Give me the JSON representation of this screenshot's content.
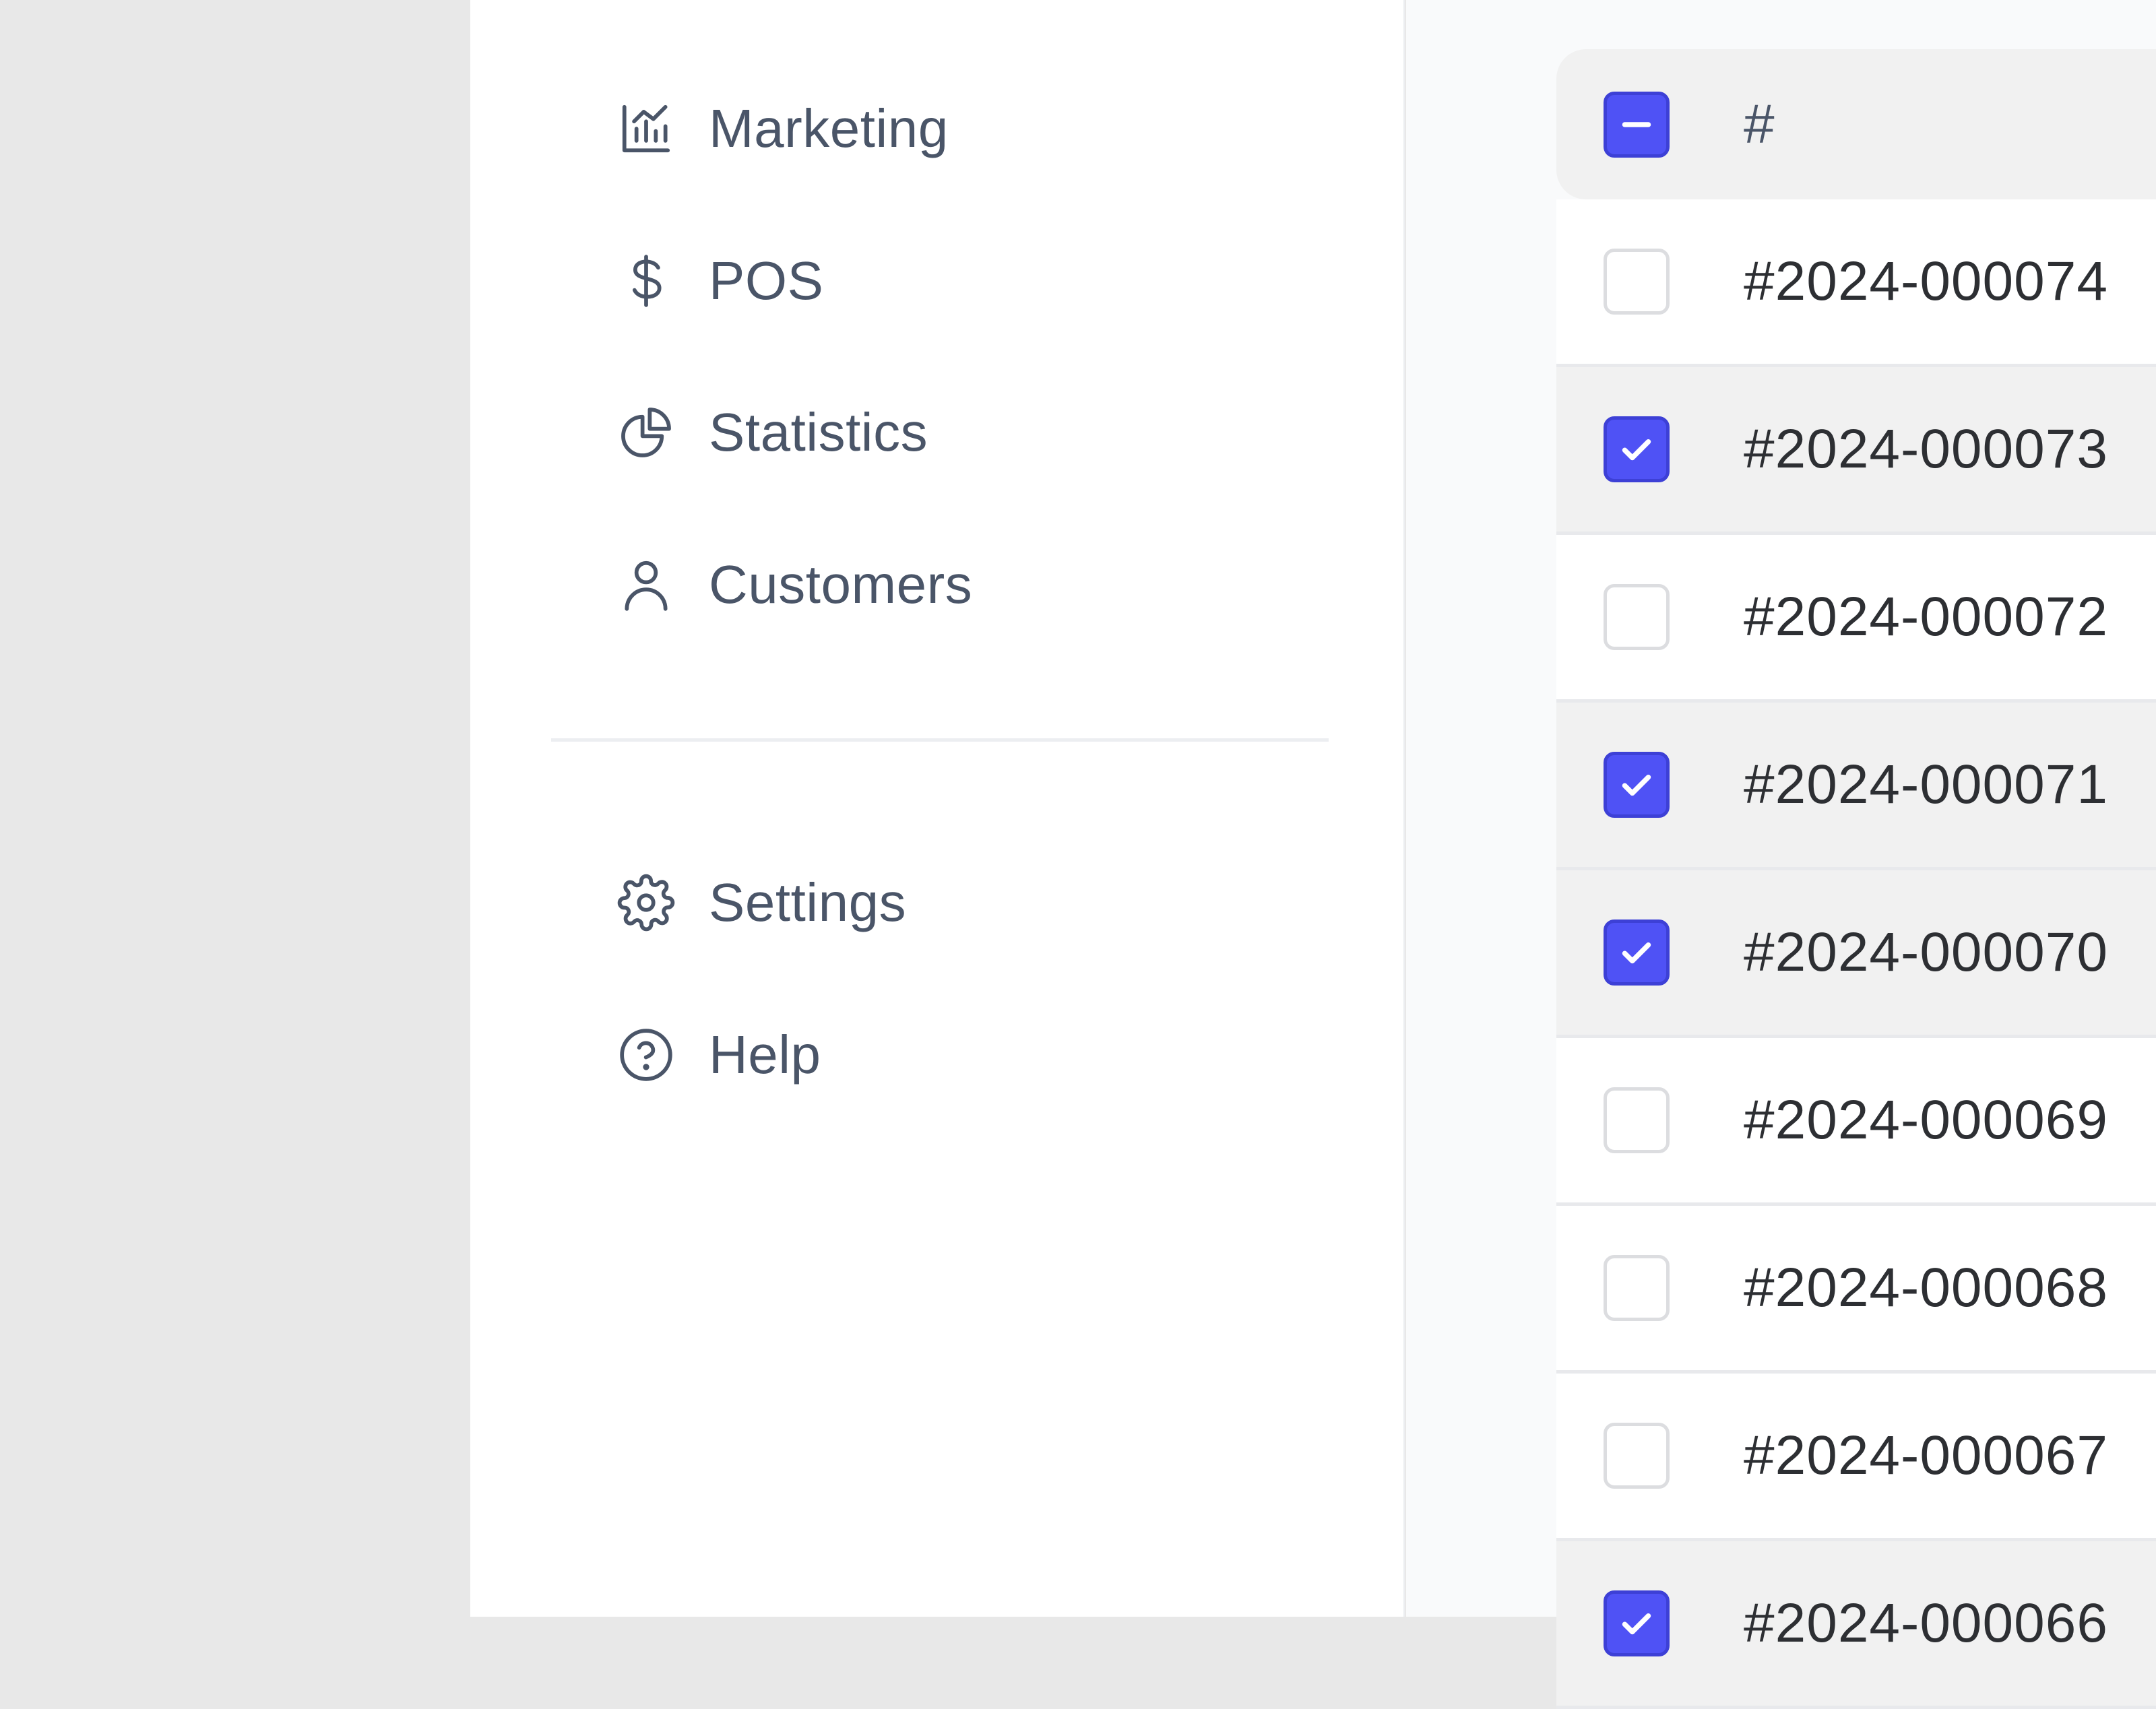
{
  "sidebar": {
    "primary_items": [
      {
        "label": "Marketing",
        "icon": "chart-icon"
      },
      {
        "label": "POS",
        "icon": "dollar-icon"
      },
      {
        "label": "Statistics",
        "icon": "pie-chart-icon"
      },
      {
        "label": "Customers",
        "icon": "user-icon"
      }
    ],
    "secondary_items": [
      {
        "label": "Settings",
        "icon": "gear-icon"
      },
      {
        "label": "Help",
        "icon": "help-circle-icon"
      }
    ]
  },
  "table": {
    "header": {
      "id_label": "#",
      "select_all_state": "indeterminate"
    },
    "rows": [
      {
        "id": "#2024-000074",
        "checked": false
      },
      {
        "id": "#2024-000073",
        "checked": true
      },
      {
        "id": "#2024-000072",
        "checked": false
      },
      {
        "id": "#2024-000071",
        "checked": true
      },
      {
        "id": "#2024-000070",
        "checked": true
      },
      {
        "id": "#2024-000069",
        "checked": false
      },
      {
        "id": "#2024-000068",
        "checked": false
      },
      {
        "id": "#2024-000067",
        "checked": false
      },
      {
        "id": "#2024-000066",
        "checked": true
      }
    ]
  },
  "colors": {
    "accent": "#4f52f5",
    "text": "#4a5568",
    "selected_row": "#f1f1f1"
  }
}
